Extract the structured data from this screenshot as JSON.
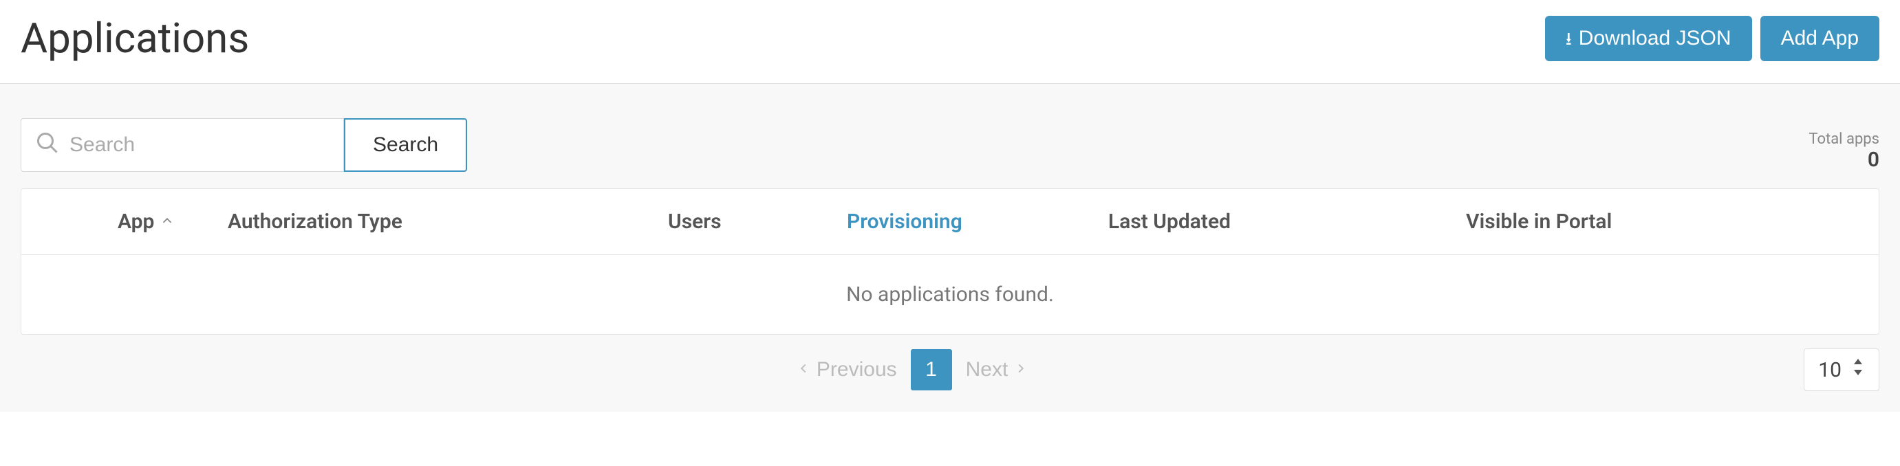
{
  "header": {
    "title": "Applications",
    "download_label": "Download JSON",
    "add_label": "Add App"
  },
  "search": {
    "placeholder": "Search",
    "button_label": "Search"
  },
  "totals": {
    "label": "Total apps",
    "value": "0"
  },
  "columns": {
    "app": "App",
    "authorization_type": "Authorization Type",
    "users": "Users",
    "provisioning": "Provisioning",
    "last_updated": "Last Updated",
    "visible_in_portal": "Visible in Portal"
  },
  "empty_message": "No applications found.",
  "pagination": {
    "previous": "Previous",
    "next": "Next",
    "current_page": "1",
    "page_size": "10"
  }
}
